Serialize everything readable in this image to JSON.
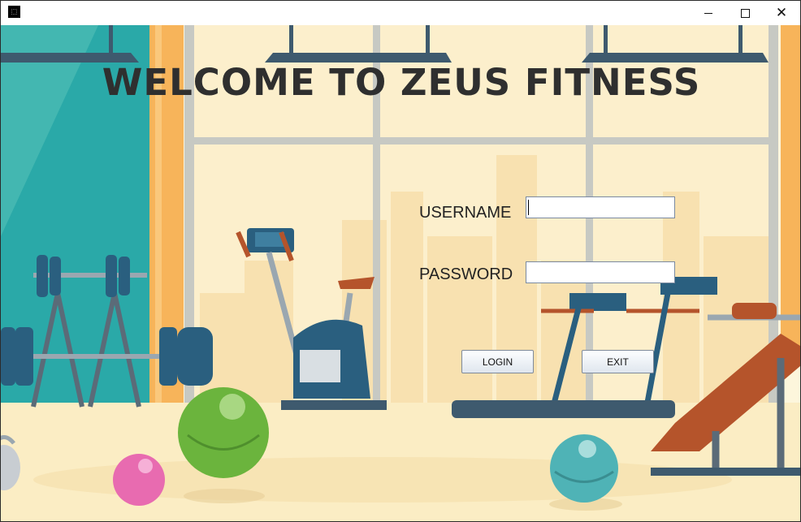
{
  "window": {
    "title": "",
    "controls": [
      "minimize-icon",
      "maximize-icon",
      "close-icon"
    ]
  },
  "headline": "WELCOME TO ZEUS FITNESS",
  "form": {
    "username_label": "USERNAME",
    "username_value": "",
    "password_label": "PASSWORD",
    "password_value": "",
    "login_label": "LOGIN",
    "exit_label": "EXIT"
  },
  "colors": {
    "headline": "#2f2f2f",
    "wall": "#fdf6dc",
    "curtain": "#f7b45a",
    "teal_wall": "#2aa9a8",
    "equipment": "#2a5f7f",
    "bench_pad": "#b5542b"
  }
}
